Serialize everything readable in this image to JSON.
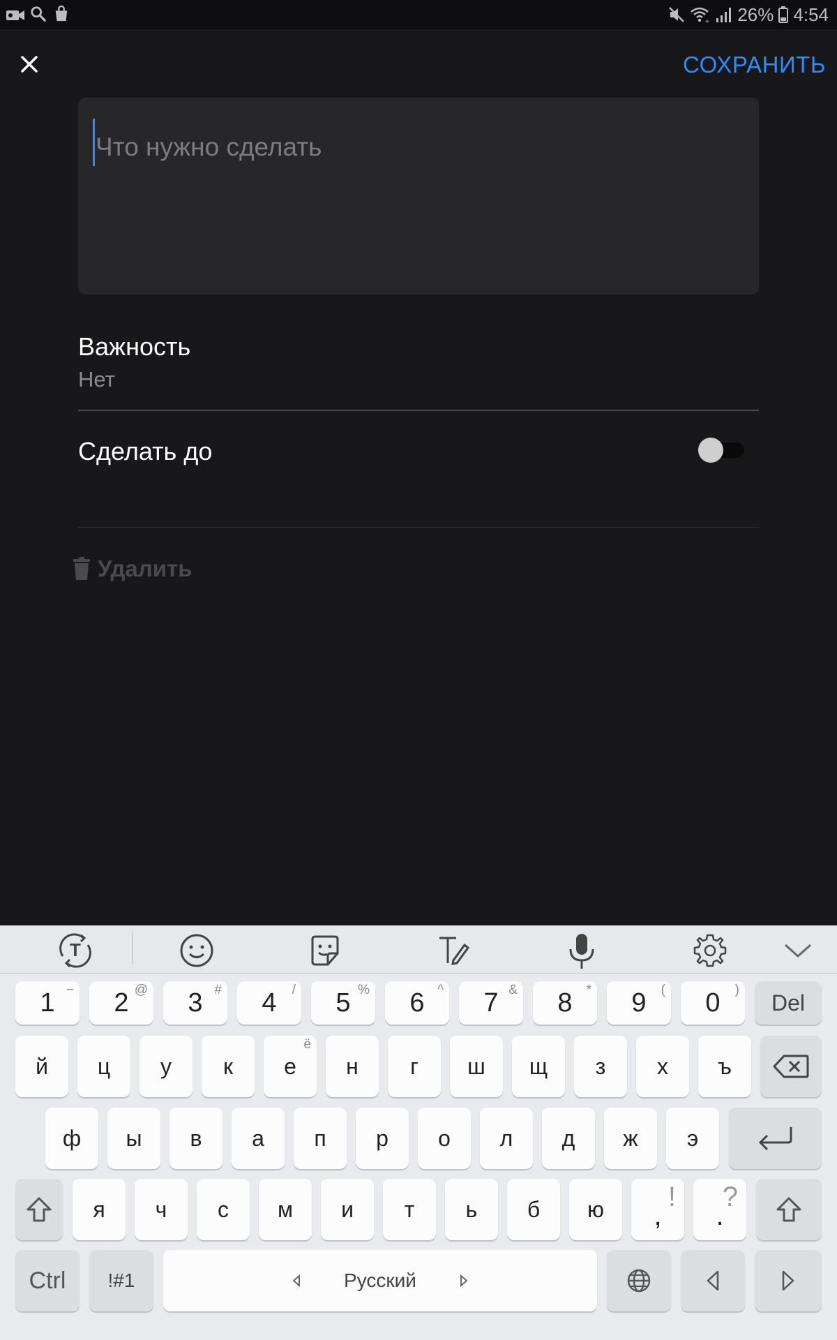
{
  "status_bar": {
    "icons_left": [
      "video-icon",
      "search-icon",
      "shopping-bag-icon"
    ],
    "battery_percent": "26%",
    "time": "4:54"
  },
  "header": {
    "save_label": "СОХРАНИТЬ"
  },
  "task": {
    "placeholder": "Что нужно сделать"
  },
  "importance": {
    "label": "Важность",
    "value": "Нет"
  },
  "due": {
    "label": "Сделать до",
    "enabled": false
  },
  "delete": {
    "label": "Удалить"
  },
  "keyboard": {
    "number_row": [
      {
        "main": "1",
        "sub": "−"
      },
      {
        "main": "2",
        "sub": "@"
      },
      {
        "main": "3",
        "sub": "#"
      },
      {
        "main": "4",
        "sub": "/"
      },
      {
        "main": "5",
        "sub": "%"
      },
      {
        "main": "6",
        "sub": "^"
      },
      {
        "main": "7",
        "sub": "&"
      },
      {
        "main": "8",
        "sub": "*"
      },
      {
        "main": "9",
        "sub": "("
      },
      {
        "main": "0",
        "sub": ")"
      }
    ],
    "del_label": "Del",
    "row1": [
      {
        "main": "й",
        "sub": ""
      },
      {
        "main": "ц",
        "sub": ""
      },
      {
        "main": "у",
        "sub": ""
      },
      {
        "main": "к",
        "sub": ""
      },
      {
        "main": "е",
        "sub": "ё"
      },
      {
        "main": "н",
        "sub": ""
      },
      {
        "main": "г",
        "sub": ""
      },
      {
        "main": "ш",
        "sub": ""
      },
      {
        "main": "щ",
        "sub": ""
      },
      {
        "main": "з",
        "sub": ""
      },
      {
        "main": "х",
        "sub": ""
      },
      {
        "main": "ъ",
        "sub": ""
      }
    ],
    "row2": [
      "ф",
      "ы",
      "в",
      "а",
      "п",
      "р",
      "о",
      "л",
      "д",
      "ж",
      "э"
    ],
    "row3": [
      {
        "main": "я",
        "sub": ""
      },
      {
        "main": "ч",
        "sub": ""
      },
      {
        "main": "с",
        "sub": ""
      },
      {
        "main": "м",
        "sub": ""
      },
      {
        "main": "и",
        "sub": ""
      },
      {
        "main": "т",
        "sub": ""
      },
      {
        "main": "ь",
        "sub": ""
      },
      {
        "main": "б",
        "sub": ""
      },
      {
        "main": "ю",
        "sub": ""
      },
      {
        "main": ",",
        "sub": "!"
      },
      {
        "main": ".",
        "sub": "?"
      }
    ],
    "ctrl_label": "Ctrl",
    "symbols_label": "!#1",
    "language_label": "Русский"
  },
  "colors": {
    "accent": "#2a8cff",
    "background": "#18181b",
    "field": "#27272a"
  }
}
